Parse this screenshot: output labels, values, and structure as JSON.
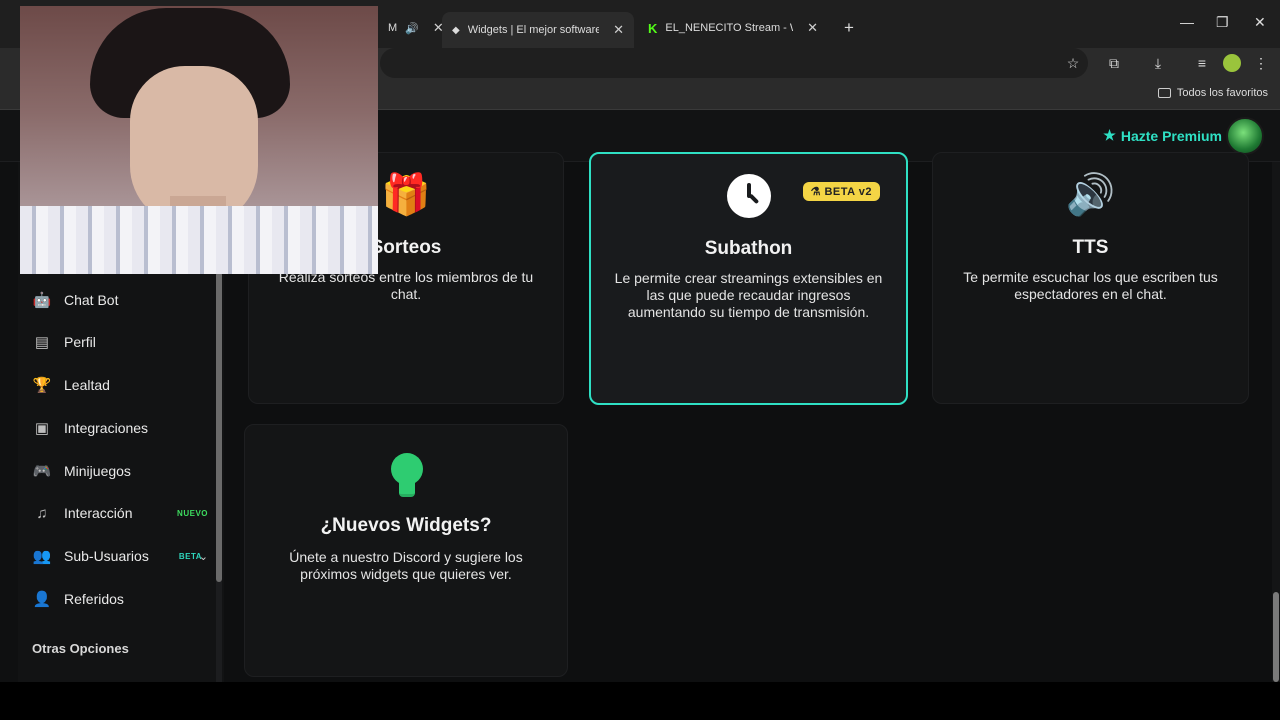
{
  "browser": {
    "tabs": [
      {
        "label": "M"
      },
      {
        "label": "Widgets | El mejor software par"
      },
      {
        "label": "EL_NENECITO Stream - Watch l"
      }
    ],
    "bookmarks_all": "Todos los favoritos"
  },
  "topbar": {
    "premium_label": "Hazte Premium"
  },
  "sidebar": {
    "items": [
      {
        "label": "Chat Bot",
        "icon": "robot-icon"
      },
      {
        "label": "Perfil",
        "icon": "id-card-icon"
      },
      {
        "label": "Lealtad",
        "icon": "trophy-icon"
      },
      {
        "label": "Integraciones",
        "icon": "plug-icon"
      },
      {
        "label": "Minijuegos",
        "icon": "gamepad-icon"
      },
      {
        "label": "Interacción",
        "icon": "music-icon",
        "badge": "NUEVO"
      },
      {
        "label": "Sub-Usuarios",
        "icon": "users-icon",
        "badge": "BETA"
      },
      {
        "label": "Referidos",
        "icon": "user-friends-icon"
      }
    ],
    "section_title": "Otras Opciones"
  },
  "cards": [
    {
      "title": "Sorteos",
      "desc": "Realiza sorteos entre los miembros de tu chat.",
      "icon": "gift-icon"
    },
    {
      "title": "Subathon",
      "desc": "Le permite crear streamings extensibles en las que puede recaudar ingresos aumentando su tiempo de transmisión.",
      "icon": "clock-icon",
      "badge": "BETA v2"
    },
    {
      "title": "TTS",
      "desc": "Te permite escuchar los que escriben tus espectadores en el chat.",
      "icon": "volume-icon"
    },
    {
      "title": "¿Nuevos Widgets?",
      "desc": "Únete a nuestro Discord y sugiere los próximos widgets que quieres ver.",
      "icon": "lightbulb-icon"
    }
  ],
  "colors": {
    "accent": "#2fe0c4",
    "new_badge": "#3ddc5f",
    "beta_pill": "#f4d545",
    "bulb": "#2ecc71"
  }
}
